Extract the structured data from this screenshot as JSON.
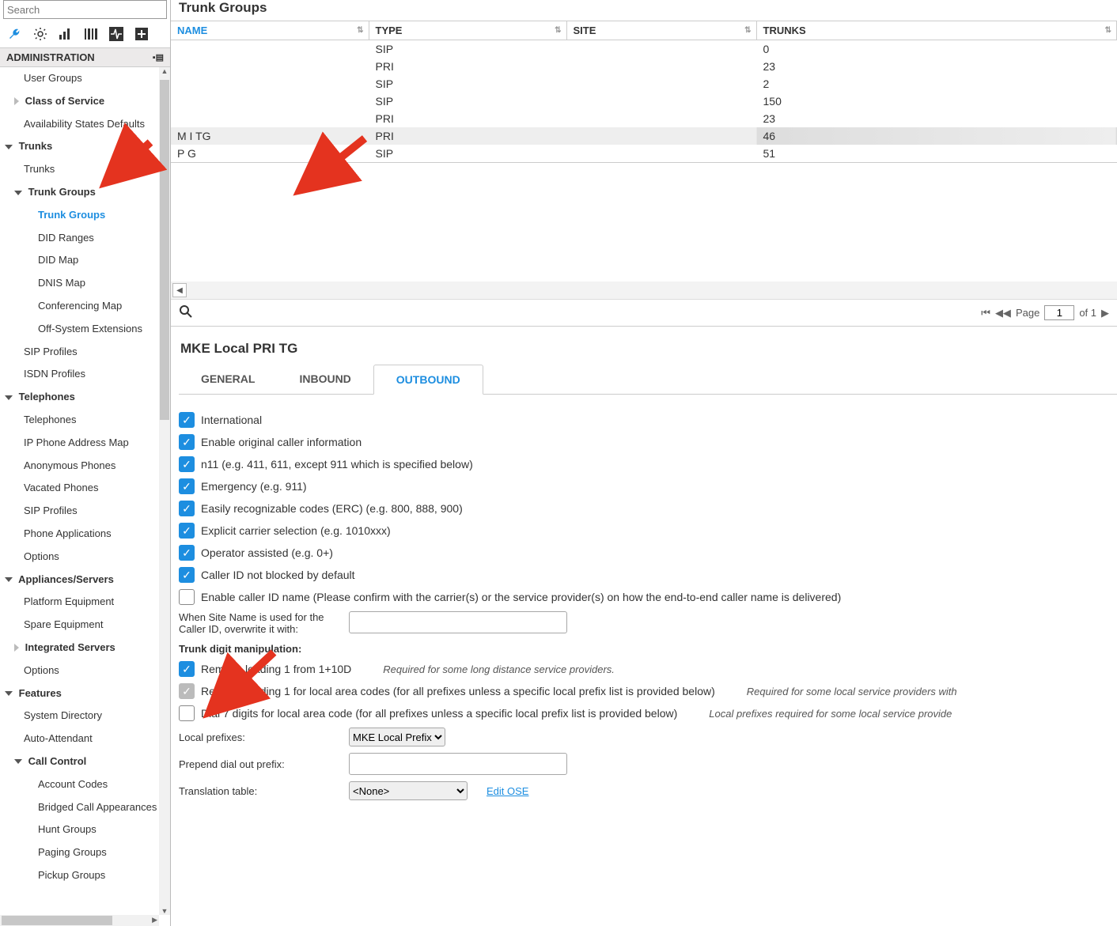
{
  "search_placeholder": "Search",
  "section_admin": "ADMINISTRATION",
  "nav": {
    "user_groups": "User Groups",
    "class_of_service": "Class of Service",
    "avail_states": "Availability States Defaults",
    "trunks": "Trunks",
    "trunks_sub": "Trunks",
    "trunk_groups": "Trunk Groups",
    "trunk_groups_sub": "Trunk Groups",
    "did_ranges": "DID Ranges",
    "did_map": "DID Map",
    "dnis_map": "DNIS Map",
    "conf_map": "Conferencing Map",
    "off_system": "Off-System Extensions",
    "sip_profiles": "SIP Profiles",
    "isdn_profiles": "ISDN Profiles",
    "telephones": "Telephones",
    "telephones_sub": "Telephones",
    "ip_phone_map": "IP Phone Address Map",
    "anon_phones": "Anonymous Phones",
    "vacated_phones": "Vacated Phones",
    "sip_profiles2": "SIP Profiles",
    "phone_apps": "Phone Applications",
    "options": "Options",
    "appliances": "Appliances/Servers",
    "platform_eq": "Platform Equipment",
    "spare_eq": "Spare Equipment",
    "integrated": "Integrated Servers",
    "options2": "Options",
    "features": "Features",
    "sys_dir": "System Directory",
    "auto_att": "Auto-Attendant",
    "call_control": "Call Control",
    "acct_codes": "Account Codes",
    "bca": "Bridged Call Appearances",
    "hunt_groups": "Hunt Groups",
    "paging_groups": "Paging Groups",
    "pickup_groups": "Pickup Groups"
  },
  "page_title": "Trunk Groups",
  "columns": {
    "name": "NAME",
    "type": "TYPE",
    "site": "SITE",
    "trunks": "TRUNKS"
  },
  "rows": [
    {
      "name": "",
      "type": "SIP",
      "site": "",
      "trunks": "0"
    },
    {
      "name": "",
      "type": "PRI",
      "site": "",
      "trunks": "23"
    },
    {
      "name": "",
      "type": "SIP",
      "site": "",
      "trunks": "2"
    },
    {
      "name": "",
      "type": "SIP",
      "site": "",
      "trunks": "150"
    },
    {
      "name": "",
      "type": "PRI",
      "site": "",
      "trunks": "23"
    },
    {
      "name": "M             I TG",
      "type": "PRI",
      "site": "",
      "trunks": "46",
      "selected": true
    },
    {
      "name": "P             G",
      "type": "SIP",
      "site": "",
      "trunks": "51"
    }
  ],
  "pager": {
    "page_label": "Page",
    "page": "1",
    "of_label": "of 1"
  },
  "detail_title": "MKE Local PRI TG",
  "tabs": {
    "general": "GENERAL",
    "inbound": "INBOUND",
    "outbound": "OUTBOUND"
  },
  "outbound": {
    "intl": "International",
    "orig_caller": "Enable original caller information",
    "n11": "n11 (e.g. 411, 611, except 911 which is specified below)",
    "emergency": "Emergency (e.g. 911)",
    "erc": "Easily recognizable codes (ERC) (e.g. 800, 888, 900)",
    "carrier": "Explicit carrier selection (e.g. 1010xxx)",
    "operator": "Operator assisted (e.g. 0+)",
    "cid_not_blocked": "Caller ID not blocked by default",
    "cid_name": "Enable caller ID name (Please confirm with the carrier(s) or the service provider(s) on how the end-to-end caller name is delivered)",
    "sitename_label": "When Site Name is used for the Caller ID, overwrite it with:",
    "tdm_title": "Trunk digit manipulation:",
    "remove1_10d": "Remove leading 1 from 1+10D",
    "remove1_10d_hint": "Required for some long distance service providers.",
    "remove1_local": "Remove leading 1 for local area codes (for all prefixes unless a specific local prefix list is provided below)",
    "remove1_local_hint": "Required for some local service providers with",
    "dial7": "Dial 7 digits for local area code (for all prefixes unless a specific local prefix list is provided below)",
    "dial7_hint": "Local prefixes required for some local service provide",
    "local_prefixes": "Local prefixes:",
    "local_prefix_sel": "MKE Local Prefix",
    "prepend": "Prepend dial out prefix:",
    "trans_table": "Translation table:",
    "trans_sel": "<None>",
    "edit_ose": "Edit OSE"
  }
}
